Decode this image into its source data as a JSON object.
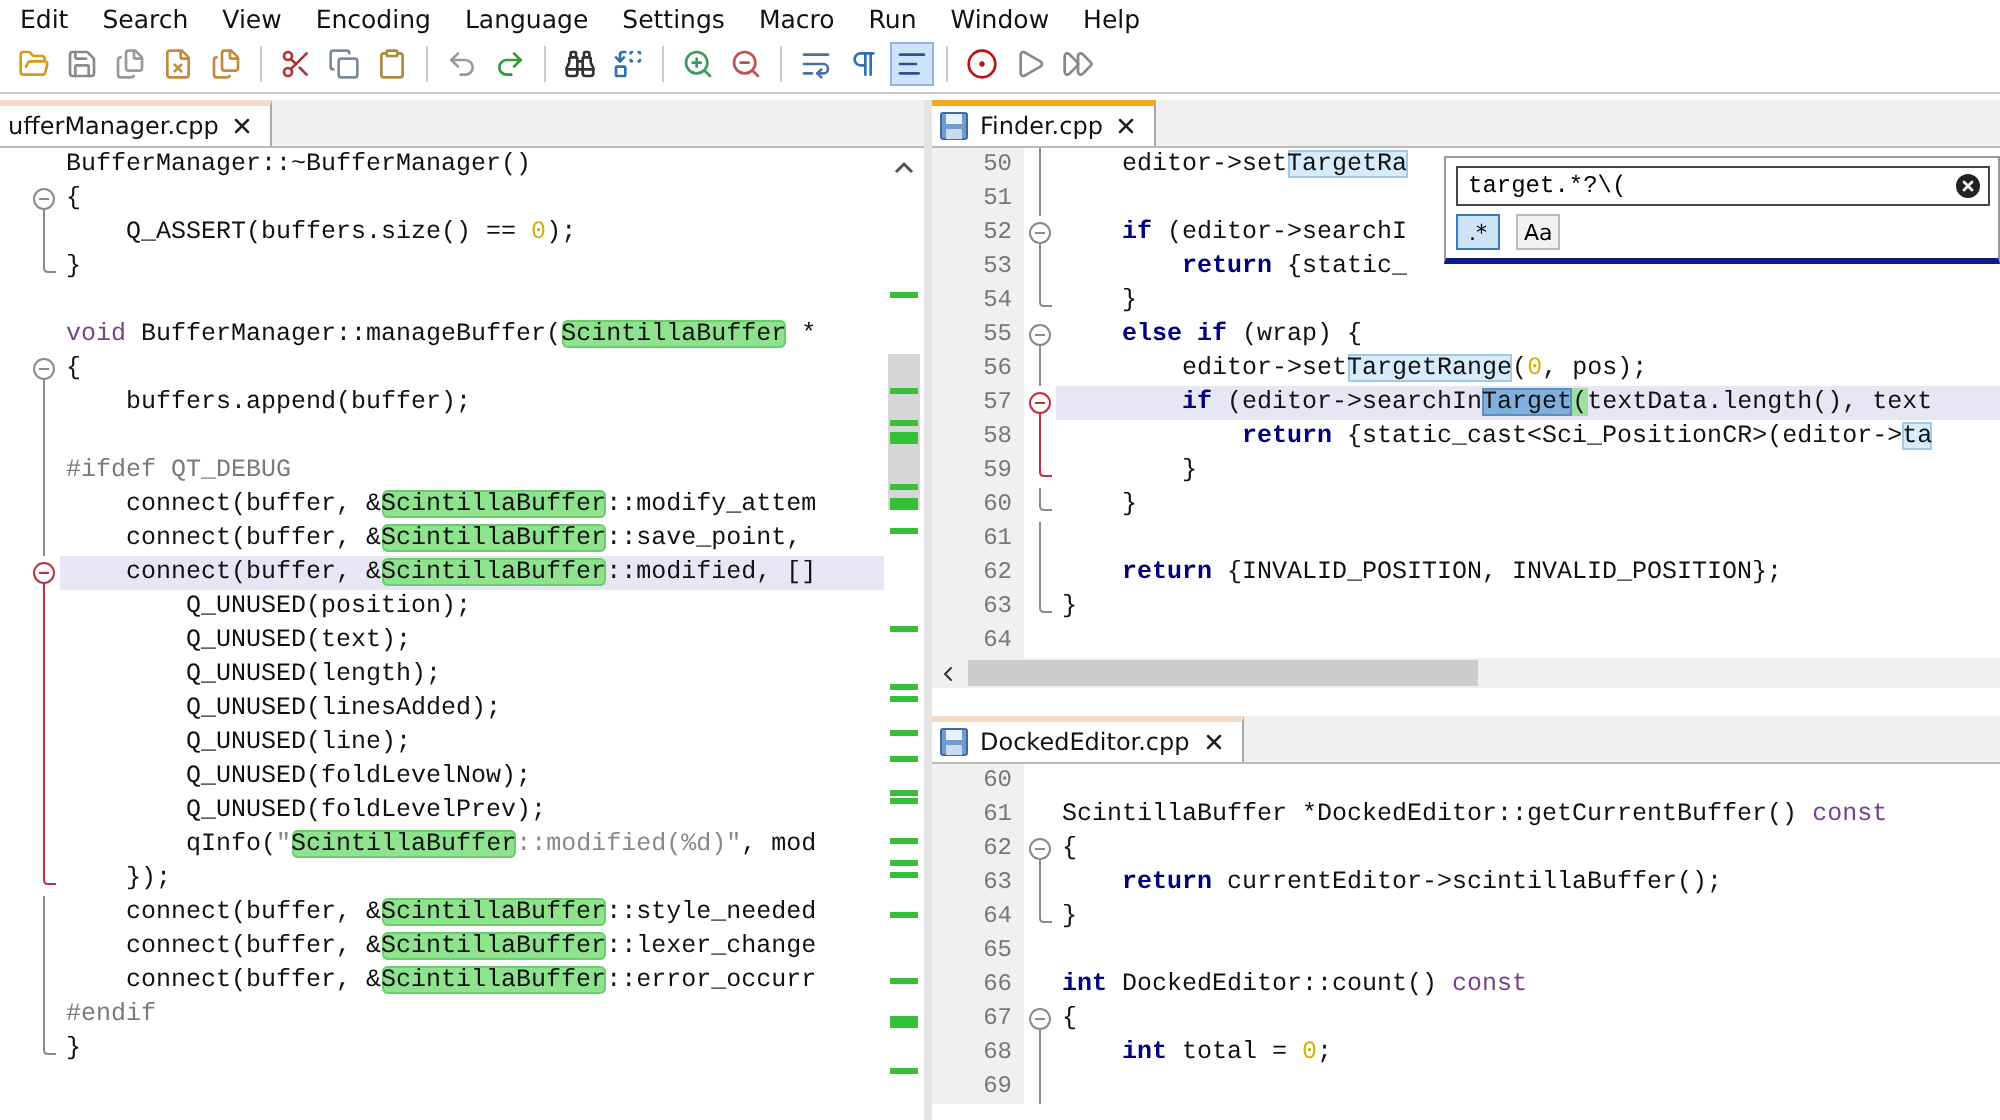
{
  "menu": [
    "Edit",
    "Search",
    "View",
    "Encoding",
    "Language",
    "Settings",
    "Macro",
    "Run",
    "Window",
    "Help"
  ],
  "toolbar": [
    {
      "kind": "open",
      "pressed": false
    },
    {
      "kind": "save",
      "pressed": false
    },
    {
      "kind": "saveall",
      "pressed": false
    },
    {
      "kind": "close",
      "pressed": false
    },
    {
      "kind": "closeall",
      "pressed": false
    },
    {
      "kind": "separator"
    },
    {
      "kind": "cut",
      "pressed": false
    },
    {
      "kind": "copy",
      "pressed": false
    },
    {
      "kind": "paste",
      "pressed": false
    },
    {
      "kind": "separator"
    },
    {
      "kind": "undo",
      "pressed": false
    },
    {
      "kind": "redo",
      "pressed": false
    },
    {
      "kind": "separator"
    },
    {
      "kind": "find",
      "pressed": false
    },
    {
      "kind": "replace",
      "pressed": false
    },
    {
      "kind": "separator"
    },
    {
      "kind": "zoomin",
      "pressed": false
    },
    {
      "kind": "zoomout",
      "pressed": false
    },
    {
      "kind": "separator"
    },
    {
      "kind": "wrap",
      "pressed": false
    },
    {
      "kind": "pilcrow",
      "pressed": false
    },
    {
      "kind": "indent",
      "pressed": true
    },
    {
      "kind": "separator"
    },
    {
      "kind": "record",
      "pressed": false
    },
    {
      "kind": "play",
      "pressed": false
    },
    {
      "kind": "playall",
      "pressed": false
    }
  ],
  "panes": [
    {
      "tab": {
        "label": "ufferManager.cpp",
        "selected": false
      },
      "lines": [
        {
          "kind": "plain",
          "current": false,
          "segments": [
            {
              "text": "BufferManager::~BufferManager()",
              "kind": "plain"
            }
          ]
        },
        {
          "kind": "foldstart",
          "active": false,
          "current": false,
          "segments": [
            {
              "text": "{",
              "kind": "plain"
            }
          ]
        },
        {
          "kind": "foldbody",
          "active": false,
          "current": false,
          "segments": [
            {
              "text": "    Q_ASSERT(buffers.size() == ",
              "kind": "plain"
            },
            {
              "text": "0",
              "kind": "number"
            },
            {
              "text": ");",
              "kind": "plain"
            }
          ]
        },
        {
          "kind": "foldend",
          "active": false,
          "current": false,
          "segments": [
            {
              "text": "}",
              "kind": "plain"
            }
          ]
        },
        {
          "kind": "blank"
        },
        {
          "kind": "plain",
          "current": false,
          "segments": [
            {
              "text": "void",
              "kind": "modifier"
            },
            {
              "text": " BufferManager::manageBuffer(",
              "kind": "plain"
            },
            {
              "text": "ScintillaBuffer",
              "kind": "match"
            },
            {
              "text": " *",
              "kind": "plain"
            }
          ]
        },
        {
          "kind": "foldstart",
          "active": false,
          "current": false,
          "segments": [
            {
              "text": "{",
              "kind": "plain"
            }
          ]
        },
        {
          "kind": "foldbody",
          "active": false,
          "current": false,
          "segments": [
            {
              "text": "    buffers.append(buffer);",
              "kind": "plain"
            }
          ]
        },
        {
          "kind": "foldbody",
          "active": false
        },
        {
          "kind": "foldbody",
          "active": false,
          "current": false,
          "segments": [
            {
              "text": "#ifdef QT_DEBUG",
              "kind": "preproc"
            }
          ]
        },
        {
          "kind": "foldbody",
          "active": false,
          "current": false,
          "segments": [
            {
              "text": "    connect(buffer, &",
              "kind": "plain"
            },
            {
              "text": "ScintillaBuffer",
              "kind": "match"
            },
            {
              "text": "::modify_attem",
              "kind": "plain"
            }
          ]
        },
        {
          "kind": "foldbody",
          "active": false,
          "current": false,
          "segments": [
            {
              "text": "    connect(buffer, &",
              "kind": "plain"
            },
            {
              "text": "ScintillaBuffer",
              "kind": "match"
            },
            {
              "text": "::save_point,",
              "kind": "plain"
            }
          ]
        },
        {
          "kind": "foldstart",
          "active": true,
          "current": true,
          "segments": [
            {
              "text": "    connect(buffer, &",
              "kind": "plain"
            },
            {
              "text": "ScintillaBuffer",
              "kind": "match"
            },
            {
              "text": "::modified, []",
              "kind": "plain"
            }
          ]
        },
        {
          "kind": "foldbody",
          "active": true,
          "current": false,
          "segments": [
            {
              "text": "        Q_UNUSED(position);",
              "kind": "plain"
            }
          ]
        },
        {
          "kind": "foldbody",
          "active": true,
          "current": false,
          "segments": [
            {
              "text": "        Q_UNUSED(text);",
              "kind": "plain"
            }
          ]
        },
        {
          "kind": "foldbody",
          "active": true,
          "current": false,
          "segments": [
            {
              "text": "        Q_UNUSED(length);",
              "kind": "plain"
            }
          ]
        },
        {
          "kind": "foldbody",
          "active": true,
          "current": false,
          "segments": [
            {
              "text": "        Q_UNUSED(linesAdded);",
              "kind": "plain"
            }
          ]
        },
        {
          "kind": "foldbody",
          "active": true,
          "current": false,
          "segments": [
            {
              "text": "        Q_UNUSED(line);",
              "kind": "plain"
            }
          ]
        },
        {
          "kind": "foldbody",
          "active": true,
          "current": false,
          "segments": [
            {
              "text": "        Q_UNUSED(foldLevelNow);",
              "kind": "plain"
            }
          ]
        },
        {
          "kind": "foldbody",
          "active": true,
          "current": false,
          "segments": [
            {
              "text": "        Q_UNUSED(foldLevelPrev);",
              "kind": "plain"
            }
          ]
        },
        {
          "kind": "foldbody",
          "active": true,
          "current": false,
          "segments": [
            {
              "text": "        qInfo(",
              "kind": "plain"
            },
            {
              "text": "\"",
              "kind": "string"
            },
            {
              "text": "ScintillaBuffer",
              "kind": "match"
            },
            {
              "text": "::modified(%d)\"",
              "kind": "string"
            },
            {
              "text": ", mod",
              "kind": "plain"
            }
          ]
        },
        {
          "kind": "foldend",
          "active": true,
          "current": false,
          "segments": [
            {
              "text": "    });",
              "kind": "plain"
            }
          ]
        },
        {
          "kind": "foldbody",
          "active": false,
          "current": false,
          "segments": [
            {
              "text": "    connect(buffer, &",
              "kind": "plain"
            },
            {
              "text": "ScintillaBuffer",
              "kind": "match"
            },
            {
              "text": "::style_needed",
              "kind": "plain"
            }
          ]
        },
        {
          "kind": "foldbody",
          "active": false,
          "current": false,
          "segments": [
            {
              "text": "    connect(buffer, &",
              "kind": "plain"
            },
            {
              "text": "ScintillaBuffer",
              "kind": "match"
            },
            {
              "text": "::lexer_change",
              "kind": "plain"
            }
          ]
        },
        {
          "kind": "foldbody",
          "active": false,
          "current": false,
          "segments": [
            {
              "text": "    connect(buffer, &",
              "kind": "plain"
            },
            {
              "text": "ScintillaBuffer",
              "kind": "match"
            },
            {
              "text": "::error_occurr",
              "kind": "plain"
            }
          ]
        },
        {
          "kind": "foldbody",
          "active": false,
          "current": false,
          "segments": [
            {
              "text": "#endif",
              "kind": "preproc"
            }
          ]
        },
        {
          "kind": "foldend",
          "active": false,
          "current": false,
          "segments": [
            {
              "text": "}",
              "kind": "plain"
            }
          ]
        }
      ]
    },
    {
      "tab": {
        "label": "Finder.cpp",
        "selected": true
      },
      "find_box": {
        "value": "target.*?\\(",
        "options": [
          {
            "label": ".*",
            "selected": true
          },
          {
            "label": "Aa",
            "selected": false
          }
        ]
      },
      "lines": [
        {
          "number": "50",
          "kind": "foldbody",
          "active": false,
          "current": false,
          "segments": [
            {
              "text": "    editor->set",
              "kind": "plain"
            },
            {
              "text": "TargetRa",
              "kind": "target"
            }
          ]
        },
        {
          "number": "51",
          "kind": "foldbody",
          "active": false
        },
        {
          "number": "52",
          "kind": "foldstart",
          "active": false,
          "current": false,
          "segments": [
            {
              "text": "    if",
              "kind": "keyword"
            },
            {
              "text": " (editor->searchI",
              "kind": "plain"
            }
          ]
        },
        {
          "number": "53",
          "kind": "foldbody",
          "active": false,
          "current": false,
          "segments": [
            {
              "text": "        return",
              "kind": "keyword"
            },
            {
              "text": " {static_",
              "kind": "plain"
            }
          ]
        },
        {
          "number": "54",
          "kind": "foldend",
          "active": false,
          "current": false,
          "segments": [
            {
              "text": "    }",
              "kind": "plain"
            }
          ]
        },
        {
          "number": "55",
          "kind": "foldstart",
          "active": false,
          "current": false,
          "segments": [
            {
              "text": "    else if",
              "kind": "keyword"
            },
            {
              "text": " (wrap) {",
              "kind": "plain"
            }
          ]
        },
        {
          "number": "56",
          "kind": "foldbody",
          "active": false,
          "current": false,
          "segments": [
            {
              "text": "        editor->set",
              "kind": "plain"
            },
            {
              "text": "TargetRange",
              "kind": "target"
            },
            {
              "text": "(",
              "kind": "plain"
            },
            {
              "text": "0",
              "kind": "number"
            },
            {
              "text": ", pos);",
              "kind": "plain"
            }
          ]
        },
        {
          "number": "57",
          "kind": "foldstart",
          "active": true,
          "current": true,
          "segments": [
            {
              "text": "        if",
              "kind": "keyword"
            },
            {
              "text": " (editor->searchIn",
              "kind": "plain"
            },
            {
              "text": "Target",
              "kind": "found"
            },
            {
              "text": "(",
              "kind": "brace"
            },
            {
              "text": "textData.length(), text",
              "kind": "plain"
            }
          ]
        },
        {
          "number": "58",
          "kind": "foldbody",
          "active": true,
          "current": false,
          "segments": [
            {
              "text": "            return",
              "kind": "keyword"
            },
            {
              "text": " {static_cast<Sci_PositionCR>(editor->",
              "kind": "plain"
            },
            {
              "text": "ta",
              "kind": "target"
            }
          ]
        },
        {
          "number": "59",
          "kind": "foldend",
          "active": true,
          "current": false,
          "segments": [
            {
              "text": "        }",
              "kind": "plain"
            }
          ]
        },
        {
          "number": "60",
          "kind": "foldend",
          "active": false,
          "current": false,
          "segments": [
            {
              "text": "    }",
              "kind": "plain"
            }
          ]
        },
        {
          "number": "61",
          "kind": "foldbody",
          "active": false
        },
        {
          "number": "62",
          "kind": "foldbody",
          "active": false,
          "current": false,
          "segments": [
            {
              "text": "    return",
              "kind": "keyword"
            },
            {
              "text": " {INVALID_POSITION, INVALID_POSITION};",
              "kind": "plain"
            }
          ]
        },
        {
          "number": "63",
          "kind": "foldend",
          "active": false,
          "current": false,
          "segments": [
            {
              "text": "}",
              "kind": "plain"
            }
          ]
        },
        {
          "number": "64",
          "kind": "blank"
        }
      ]
    },
    {
      "tab": {
        "label": "DockedEditor.cpp",
        "selected": false
      },
      "lines": [
        {
          "number": "60",
          "kind": "blank"
        },
        {
          "number": "61",
          "kind": "plain",
          "current": false,
          "segments": [
            {
              "text": "ScintillaBuffer *DockedEditor::getCurrentBuffer() ",
              "kind": "plain"
            },
            {
              "text": "const",
              "kind": "modifier"
            }
          ]
        },
        {
          "number": "62",
          "kind": "foldstart",
          "active": false,
          "current": false,
          "segments": [
            {
              "text": "{",
              "kind": "plain"
            }
          ]
        },
        {
          "number": "63",
          "kind": "foldbody",
          "active": false,
          "current": false,
          "segments": [
            {
              "text": "    return",
              "kind": "keyword"
            },
            {
              "text": " currentEditor->scintillaBuffer();",
              "kind": "plain"
            }
          ]
        },
        {
          "number": "64",
          "kind": "foldend",
          "active": false,
          "current": false,
          "segments": [
            {
              "text": "}",
              "kind": "plain"
            }
          ]
        },
        {
          "number": "65",
          "kind": "blank"
        },
        {
          "number": "66",
          "kind": "plain",
          "current": false,
          "segments": [
            {
              "text": "int",
              "kind": "keyword"
            },
            {
              "text": " DockedEditor::count() ",
              "kind": "plain"
            },
            {
              "text": "const",
              "kind": "modifier"
            }
          ]
        },
        {
          "number": "67",
          "kind": "foldstart",
          "active": false,
          "current": false,
          "segments": [
            {
              "text": "{",
              "kind": "plain"
            }
          ]
        },
        {
          "number": "68",
          "kind": "foldbody",
          "active": false,
          "current": false,
          "segments": [
            {
              "text": "    int",
              "kind": "keyword"
            },
            {
              "text": " total = ",
              "kind": "plain"
            },
            {
              "text": "0",
              "kind": "number"
            },
            {
              "text": ";",
              "kind": "plain"
            }
          ]
        },
        {
          "number": "69",
          "kind": "foldbody",
          "active": false
        }
      ]
    }
  ]
}
